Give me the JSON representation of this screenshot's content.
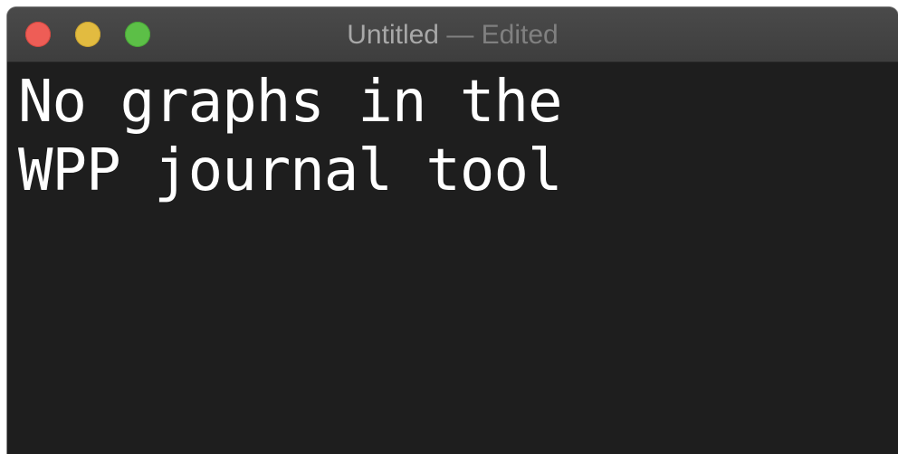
{
  "window": {
    "title": "Untitled",
    "separator": " — ",
    "status": "Edited"
  },
  "editor": {
    "lines": [
      "No graphs in the",
      "WPP journal tool"
    ]
  },
  "colors": {
    "close": "#ee5d56",
    "minimize": "#e2bb40",
    "zoom": "#5cbf47",
    "editor_background": "#1e1e1e",
    "text": "#ffffff"
  }
}
